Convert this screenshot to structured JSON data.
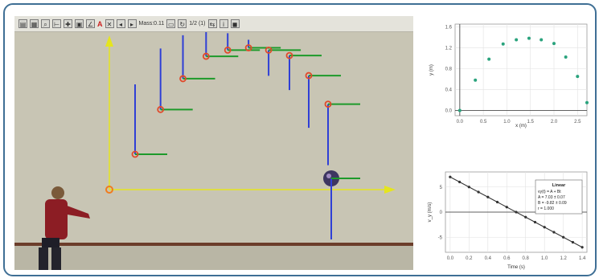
{
  "toolbar": {
    "buttons": [
      "file-icon",
      "open-icon",
      "zoom-icon",
      "calibrate-icon",
      "origin-icon",
      "track-icon",
      "protractor-icon",
      "text-icon",
      "delete-icon",
      "prev-icon",
      "next-icon",
      "window-icon",
      "rotate-icon",
      "flip-icon",
      "info-icon",
      "help-icon",
      "camera-icon"
    ],
    "text_a": "A",
    "text_b": "Mass:0.11",
    "text_c": "1/2 (1)"
  },
  "colors": {
    "accent": "#3f6f95",
    "trajectory_point": "#e04a2b",
    "velocity_vector": "#2f3fd6",
    "horizontal_vector": "#1d9a2a",
    "axis": "#e5e51e",
    "plot_point": "#2aa37d"
  },
  "chart_data": [
    {
      "type": "scatter",
      "xlabel": "x (m)",
      "ylabel": "y (m)",
      "xticks": [
        "0.0",
        "0.5",
        "1.0",
        "1.5",
        "2.0",
        "2.5"
      ],
      "yticks": [
        "0.0",
        "0.4",
        "0.8",
        "1.2",
        "1.6"
      ],
      "xlim": [
        -0.1,
        2.7
      ],
      "ylim": [
        -0.1,
        1.65
      ],
      "x": [
        0.0,
        0.33,
        0.62,
        0.92,
        1.2,
        1.47,
        1.73,
        2.0,
        2.25,
        2.5,
        2.7
      ],
      "y": [
        0.0,
        0.58,
        0.98,
        1.27,
        1.35,
        1.38,
        1.35,
        1.28,
        1.02,
        0.65,
        0.15
      ],
      "grid": true
    },
    {
      "type": "line",
      "xlabel": "Time (s)",
      "ylabel": "v_y (m/s)",
      "xticks": [
        "0.0",
        "0.2",
        "0.4",
        "0.6",
        "0.8",
        "1.0",
        "1.2",
        "1.4"
      ],
      "yticks": [
        "5",
        "0",
        "-5"
      ],
      "xlim": [
        -0.05,
        1.45
      ],
      "ylim": [
        -8,
        8
      ],
      "x": [
        0.0,
        0.1,
        0.2,
        0.3,
        0.4,
        0.5,
        0.6,
        0.7,
        0.8,
        0.9,
        1.0,
        1.1,
        1.2,
        1.3,
        1.4
      ],
      "y": [
        7.0,
        6.0,
        5.0,
        4.0,
        3.0,
        2.0,
        1.0,
        0.0,
        -1.0,
        -2.0,
        -3.0,
        -4.0,
        -5.0,
        -6.0,
        -7.0
      ],
      "grid": true,
      "annotation": {
        "title": "Linear",
        "lines": [
          "vy(t) = A + Bt",
          "A = 7.03 ± 0.07",
          "B = -9.82 ± 0.09",
          "r = 1.000"
        ]
      }
    }
  ]
}
